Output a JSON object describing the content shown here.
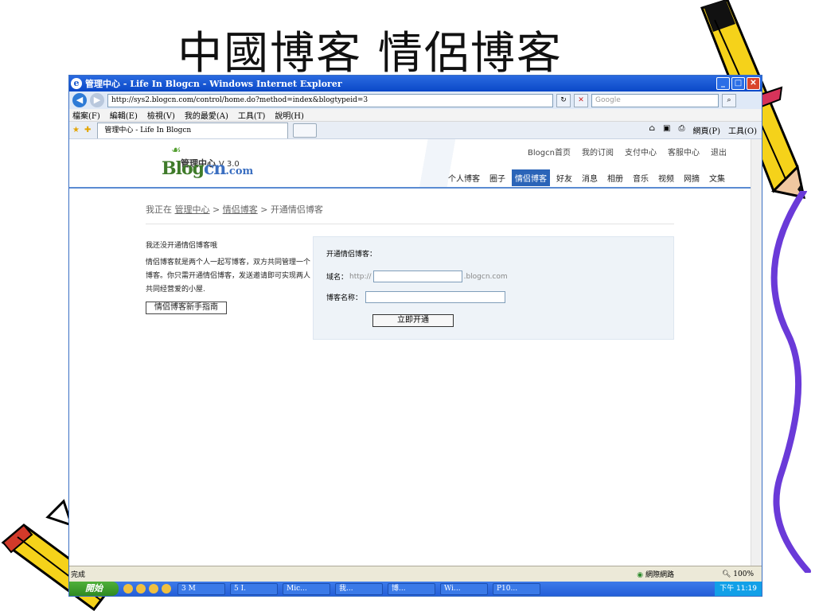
{
  "slide": {
    "title": "中國博客 情侶博客"
  },
  "window": {
    "title": "管理中心 - Life In Blogcn - Windows Internet Explorer"
  },
  "addressbar": {
    "url": "http://sys2.blogcn.com/control/home.do?method=index&blogtypeid=3",
    "search_placeholder": "Google"
  },
  "menu": [
    "檔案(F)",
    "編輯(E)",
    "檢視(V)",
    "我的最愛(A)",
    "工具(T)",
    "說明(H)"
  ],
  "tab": {
    "title": "管理中心 - Life In Blogcn"
  },
  "commandbar": {
    "page": "網頁(P)",
    "tools": "工具(O)"
  },
  "site": {
    "logo_sub": "管理中心",
    "version": "V 3.0",
    "logo_main_a": "Bl",
    "logo_main_b": "og",
    "logo_main_c": "cn",
    "logo_dotcom": ".com",
    "top_links": [
      "Blogcn首页",
      "我的订阅",
      "支付中心",
      "客服中心",
      "退出"
    ],
    "nav": [
      "个人博客",
      "圈子",
      "情侣博客",
      "好友",
      "消息",
      "相册",
      "音乐",
      "视频",
      "网摘",
      "文集"
    ],
    "nav_active_index": 2
  },
  "breadcrumb": {
    "prefix": "我正在",
    "home": "管理中心",
    "section": "情侣博客",
    "current": "开通情侣博客",
    "sep": ">"
  },
  "intro": {
    "line1": "我还没开通情侣博客哦",
    "para": "情侣博客就是两个人一起写博客，双方共同管理一个博客。你只需开通情侣博客，发送邀请即可实现两人共同经营爱的小屋.",
    "guide_button": "情侣博客新手指南"
  },
  "open_form": {
    "heading": "开通情侣博客：",
    "domain_label": "域名：",
    "domain_prefix": "http://",
    "domain_suffix": ".blogcn.com",
    "name_label": "博客名称：",
    "submit": "立即开通"
  },
  "status": {
    "left": "完成",
    "zone": "網際網路",
    "zoom": "100%"
  },
  "taskbar": {
    "start": "開始",
    "items": [
      "3 M",
      "5 I.",
      "Mic...",
      "我...",
      "博...",
      "Wi...",
      "P10..."
    ],
    "clock": "下午 11:19"
  }
}
